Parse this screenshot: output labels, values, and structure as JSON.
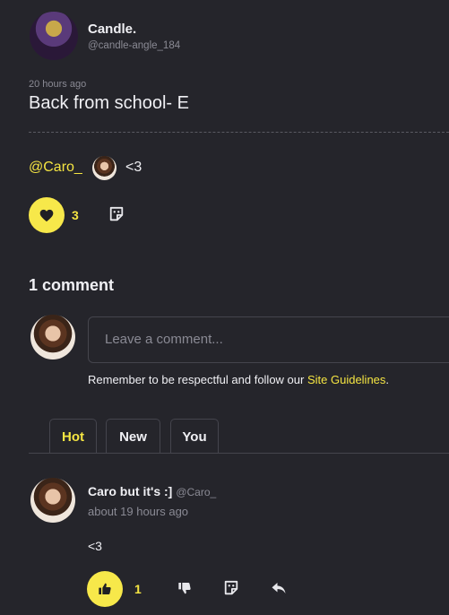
{
  "post": {
    "author_name": "Candle.",
    "author_handle": "@candle-angle_184",
    "timestamp": "20 hours ago",
    "title": "Back from school- E",
    "mention": "@Caro_",
    "body_text": "<3",
    "like_count": "3"
  },
  "comments": {
    "heading": "1 comment",
    "input_placeholder": "Leave a comment...",
    "guidelines_prefix": "Remember to be respectful and follow our ",
    "guidelines_link": "Site Guidelines",
    "guidelines_suffix": ".",
    "tabs": [
      {
        "label": "Hot",
        "active": true
      },
      {
        "label": "New",
        "active": false
      },
      {
        "label": "You",
        "active": false
      }
    ],
    "items": [
      {
        "author_name": "Caro but it's :]",
        "author_handle": "@Caro_",
        "time": "about 19 hours ago",
        "text": "<3",
        "like_count": "1"
      }
    ]
  },
  "colors": {
    "background": "#25252b",
    "accent": "#f5e542",
    "muted": "#8a8a94"
  },
  "icons": [
    "heart-icon",
    "sticker-icon",
    "thumbs-up-icon",
    "thumbs-down-icon",
    "reply-icon"
  ]
}
